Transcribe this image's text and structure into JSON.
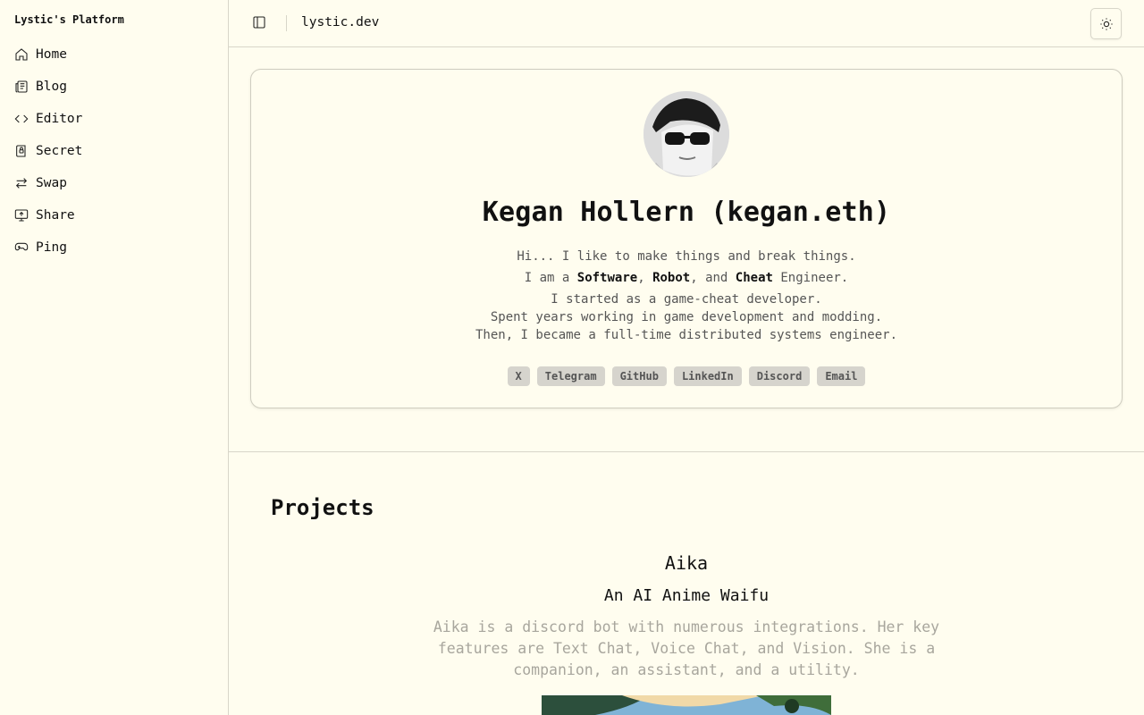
{
  "sidebar": {
    "brand": "Lystic's Platform",
    "items": [
      {
        "label": "Home",
        "icon": "home-icon"
      },
      {
        "label": "Blog",
        "icon": "newspaper-icon"
      },
      {
        "label": "Editor",
        "icon": "code-icon"
      },
      {
        "label": "Secret",
        "icon": "notebook-lock-icon"
      },
      {
        "label": "Swap",
        "icon": "arrows-swap-icon"
      },
      {
        "label": "Share",
        "icon": "monitor-upload-icon"
      },
      {
        "label": "Ping",
        "icon": "gamepad-icon"
      }
    ]
  },
  "header": {
    "toggle_icon": "panel-left-icon",
    "site_title": "lystic.dev",
    "theme_icon": "sun-icon"
  },
  "profile": {
    "name": "Kegan Hollern (kegan.eth)",
    "line1": "Hi... I like to make things and break things.",
    "line2_pre": "I am a ",
    "line2_b1": "Software",
    "line2_sep1": ", ",
    "line2_b2": "Robot",
    "line2_sep2": ", and ",
    "line2_b3": "Cheat",
    "line2_post": " Engineer.",
    "line3": "I started as a game-cheat developer.",
    "line4": "Spent years working in game development and modding.",
    "line5": "Then, I became a full-time distributed systems engineer.",
    "links": [
      "X",
      "Telegram",
      "GitHub",
      "LinkedIn",
      "Discord",
      "Email"
    ]
  },
  "projects": {
    "title": "Projects",
    "items": [
      {
        "name": "Aika",
        "tagline": "An AI Anime Waifu",
        "description": "Aika is a discord bot with numerous integrations. Her key features are Text Chat, Voice Chat, and Vision. She is a companion, an assistant, and a utility."
      }
    ]
  },
  "colors": {
    "background": "#fffdef",
    "border": "#d8d6c9",
    "chip_bg": "#d6d4cd",
    "muted_text": "#a8a69d"
  }
}
